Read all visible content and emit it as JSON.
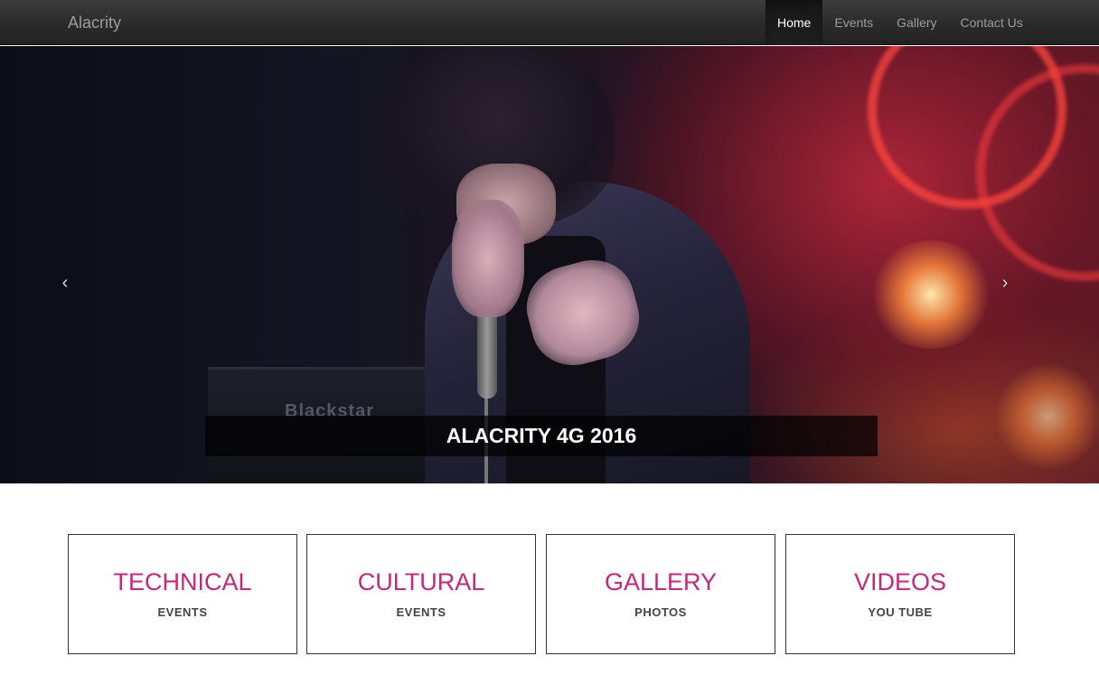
{
  "navbar": {
    "brand": "Alacrity",
    "items": [
      {
        "label": "Home",
        "active": true
      },
      {
        "label": "Events",
        "active": false
      },
      {
        "label": "Gallery",
        "active": false
      },
      {
        "label": "Contact Us",
        "active": false
      }
    ]
  },
  "carousel": {
    "prev_icon": "chevron-left-icon",
    "prev_glyph": "‹",
    "next_icon": "chevron-right-icon",
    "next_glyph": "›",
    "caption": "ALACRITY 4G 2016",
    "amp_text": "Blackstar"
  },
  "tiles": [
    {
      "title": "TECHNICAL",
      "subtitle": "EVENTS"
    },
    {
      "title": "CULTURAL",
      "subtitle": "EVENTS"
    },
    {
      "title": "GALLERY",
      "subtitle": "PHOTOS"
    },
    {
      "title": "VIDEOS",
      "subtitle": "YOU TUBE"
    }
  ],
  "colors": {
    "accent": "#c4287a",
    "navbar": "#2a2a2a",
    "nav_text": "#9d9d9d"
  }
}
